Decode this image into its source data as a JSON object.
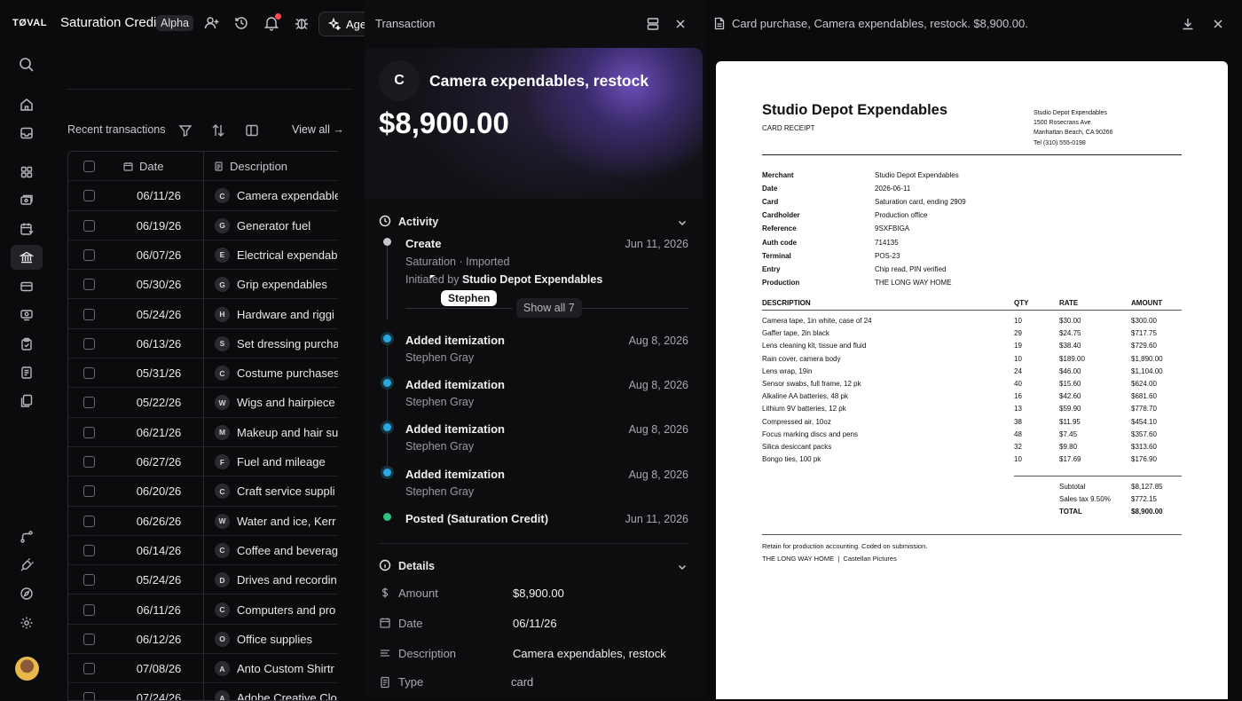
{
  "app": {
    "logo": "TØVAL",
    "title": "Saturation Credit",
    "badge": "Alpha",
    "agent_label": "Age"
  },
  "table_panel": {
    "recent_label": "Recent transactions",
    "view_all": "View all →",
    "columns": {
      "date": "Date",
      "description": "Description"
    },
    "rows": [
      {
        "date": "06/11/26",
        "initial": "C",
        "desc": "Camera expendable"
      },
      {
        "date": "06/19/26",
        "initial": "G",
        "desc": "Generator fuel"
      },
      {
        "date": "06/07/26",
        "initial": "E",
        "desc": "Electrical expendab"
      },
      {
        "date": "05/30/26",
        "initial": "G",
        "desc": "Grip expendables"
      },
      {
        "date": "05/24/26",
        "initial": "H",
        "desc": "Hardware and riggi"
      },
      {
        "date": "06/13/26",
        "initial": "S",
        "desc": "Set dressing purcha"
      },
      {
        "date": "05/31/26",
        "initial": "C",
        "desc": "Costume purchases"
      },
      {
        "date": "05/22/26",
        "initial": "W",
        "desc": "Wigs and hairpiece"
      },
      {
        "date": "06/21/26",
        "initial": "M",
        "desc": "Makeup and hair su"
      },
      {
        "date": "06/27/26",
        "initial": "F",
        "desc": "Fuel and mileage"
      },
      {
        "date": "06/20/26",
        "initial": "C",
        "desc": "Craft service suppli"
      },
      {
        "date": "06/26/26",
        "initial": "W",
        "desc": "Water and ice, Kerr"
      },
      {
        "date": "06/14/26",
        "initial": "C",
        "desc": "Coffee and beverag"
      },
      {
        "date": "05/24/26",
        "initial": "D",
        "desc": "Drives and recordin"
      },
      {
        "date": "06/11/26",
        "initial": "C",
        "desc": "Computers and pro"
      },
      {
        "date": "06/12/26",
        "initial": "O",
        "desc": "Office supplies"
      },
      {
        "date": "07/08/26",
        "initial": "A",
        "desc": "Anto Custom Shirtr"
      },
      {
        "date": "07/24/26",
        "initial": "A",
        "desc": "Adobe Creative Clo"
      }
    ]
  },
  "transaction": {
    "header": "Transaction",
    "avatar": "C",
    "title": "Camera expendables, restock",
    "amount": "$8,900.00",
    "activity": {
      "title": "Activity",
      "create": {
        "title": "Create",
        "date": "Jun 11, 2026",
        "source": "Saturation · Imported",
        "initiated_prefix": "Initiated by",
        "initiated_by": "Studio Depot Expendables",
        "tooltip": "Stephen",
        "show_all": "Show all 7"
      },
      "events": [
        {
          "title": "Added itemization",
          "user": "Stephen Gray",
          "date": "Aug 8, 2026"
        },
        {
          "title": "Added itemization",
          "user": "Stephen Gray",
          "date": "Aug 8, 2026"
        },
        {
          "title": "Added itemization",
          "user": "Stephen Gray",
          "date": "Aug 8, 2026"
        },
        {
          "title": "Added itemization",
          "user": "Stephen Gray",
          "date": "Aug 8, 2026"
        }
      ],
      "posted": {
        "title": "Posted (Saturation Credit)",
        "date": "Jun 11, 2026"
      }
    },
    "details": {
      "title": "Details",
      "amount_label": "Amount",
      "amount": "$8,900.00",
      "date_label": "Date",
      "date": "06/11/26",
      "description_label": "Description",
      "description": "Camera expendables, restock",
      "type_label": "Type",
      "type": "card"
    },
    "colors": {
      "dot_blue": "#2aa8e0",
      "dot_green": "#2ec27e",
      "dot_gray": "#c8c8cc",
      "hero_accent": "#6b4fb8"
    }
  },
  "receipt": {
    "header": "Card purchase, Camera expendables, restock. $8,900.00.",
    "store": "Studio Depot Expendables",
    "doc_type": "CARD RECEIPT",
    "address": [
      "Studio Depot Expendables",
      "1500 Rosecrans Ave",
      "Manhattan Beach, CA 90266",
      "Tel (310) 555-0198"
    ],
    "meta": [
      {
        "k": "Merchant",
        "v": "Studio Depot Expendables"
      },
      {
        "k": "Date",
        "v": "2026-06-11"
      },
      {
        "k": "Card",
        "v": "Saturation card, ending 2909"
      },
      {
        "k": "Cardholder",
        "v": "Production office"
      },
      {
        "k": "Reference",
        "v": "9SXFBIGA"
      },
      {
        "k": "Auth code",
        "v": "714135"
      },
      {
        "k": "Terminal",
        "v": "POS-23"
      },
      {
        "k": "Entry",
        "v": "Chip read, PIN verified"
      },
      {
        "k": "Production",
        "v": "THE LONG WAY HOME"
      }
    ],
    "columns": {
      "desc": "DESCRIPTION",
      "qty": "QTY",
      "rate": "RATE",
      "amount": "AMOUNT"
    },
    "items": [
      {
        "d": "Camera tape, 1in white, case of 24",
        "q": "10",
        "r": "$30.00",
        "a": "$300.00"
      },
      {
        "d": "Gaffer tape, 2in black",
        "q": "29",
        "r": "$24.75",
        "a": "$717.75"
      },
      {
        "d": "Lens cleaning kit, tissue and fluid",
        "q": "19",
        "r": "$38.40",
        "a": "$729.60"
      },
      {
        "d": "Rain cover, camera body",
        "q": "10",
        "r": "$189.00",
        "a": "$1,890.00"
      },
      {
        "d": "Lens wrap, 19in",
        "q": "24",
        "r": "$46.00",
        "a": "$1,104.00"
      },
      {
        "d": "Sensor swabs, full frame, 12 pk",
        "q": "40",
        "r": "$15.60",
        "a": "$624.00"
      },
      {
        "d": "Alkaline AA batteries, 48 pk",
        "q": "16",
        "r": "$42.60",
        "a": "$681.60"
      },
      {
        "d": "Lithium 9V batteries, 12 pk",
        "q": "13",
        "r": "$59.90",
        "a": "$778.70"
      },
      {
        "d": "Compressed air, 10oz",
        "q": "38",
        "r": "$11.95",
        "a": "$454.10"
      },
      {
        "d": "Focus marking discs and pens",
        "q": "48",
        "r": "$7.45",
        "a": "$357.60"
      },
      {
        "d": "Silica desiccant packs",
        "q": "32",
        "r": "$9.80",
        "a": "$313.60"
      },
      {
        "d": "Bongo ties, 100 pk",
        "q": "10",
        "r": "$17.69",
        "a": "$176.90"
      }
    ],
    "totals": [
      {
        "k": "Subtotal",
        "v": "$8,127.85"
      },
      {
        "k": "Sales tax 9.50%",
        "v": "$772.15"
      },
      {
        "k": "TOTAL",
        "v": "$8,900.00"
      }
    ],
    "footer": [
      "Retain for production accounting. Coded on submission.",
      "THE LONG WAY HOME  |  Castellan Pictures"
    ]
  }
}
